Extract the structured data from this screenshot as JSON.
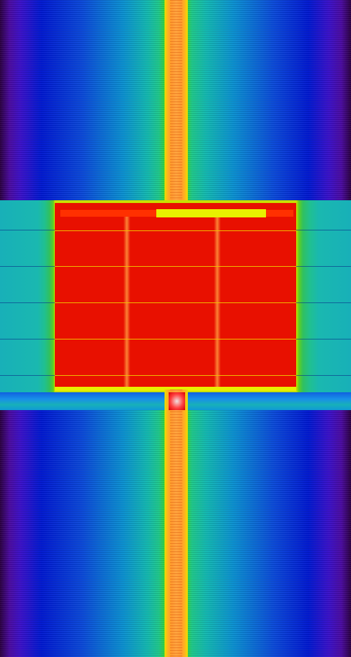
{
  "image": {
    "kind": "false-color intensity plot",
    "colormap": [
      "#2a0040",
      "#4a0aa0",
      "#0018d0",
      "#0a90d0",
      "#12b8b0",
      "#3ad82a",
      "#e8e000",
      "#ff9a30",
      "#e81000"
    ],
    "text": []
  }
}
